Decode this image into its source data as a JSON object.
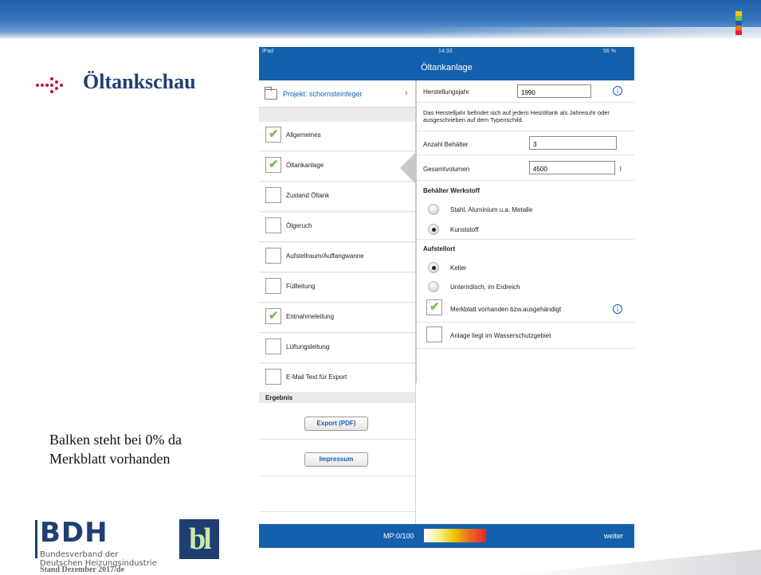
{
  "brand": {
    "accent": "#1560ad",
    "title_color": "#1f3e72",
    "check_color": "#7cc044"
  },
  "slide": {
    "title": "Öltankschau",
    "caption_line1": "Balken steht bei 0% da",
    "caption_line2": "Merkblatt vorhanden",
    "bdh_mark": "BDH",
    "bdh_sub1": "Bundesverband der",
    "bdh_sub2": "Deutschen Heizungsindustrie",
    "stand": "Stand Dezember 2017/de",
    "bl_logo": "bl"
  },
  "status": {
    "device": "iPad",
    "time": "14:33",
    "battery": "56 %"
  },
  "nav": {
    "title": "Öltankanlage"
  },
  "project": {
    "label": "Projekt: schornsteinfeger"
  },
  "sidebar": {
    "items": [
      {
        "label": "Allgemeines",
        "checked": true
      },
      {
        "label": "Öltankanlage",
        "checked": true
      },
      {
        "label": "Zustand Öltank",
        "checked": false
      },
      {
        "label": "Ölgeruch",
        "checked": false
      },
      {
        "label": "Aufstellraum/Auffangwanne",
        "checked": false
      },
      {
        "label": "Füllleitung",
        "checked": false
      },
      {
        "label": "Entnahmeleitung",
        "checked": true
      },
      {
        "label": "Lüftungsleitung",
        "checked": false
      },
      {
        "label": "E-Mail Text für Export",
        "checked": false
      }
    ],
    "section_result": "Ergebnis",
    "export_button": "Export (PDF)",
    "impressum_button": "Impressum"
  },
  "form": {
    "year_label": "Herstellungsjahr",
    "year_value": "1990",
    "hint": "Das Herstelljahr befindet sich auf jedem Heizöltank als Jahresuhr oder ausgeschrieben auf dem Typenschild.",
    "count_label": "Anzahl Behälter",
    "count_value": "3",
    "volume_label": "Gesamtvolumen",
    "volume_value": "4500",
    "volume_unit": "l",
    "material_section": "Behälter Werkstoff",
    "material_options": [
      {
        "label": "Stahl, Aluminium u.a. Metalle",
        "selected": false
      },
      {
        "label": "Kunststoff",
        "selected": true
      }
    ],
    "location_section": "Aufstellort",
    "location_options": [
      {
        "label": "Keller",
        "selected": true
      },
      {
        "label": "Unterirdisch, im Erdreich",
        "selected": false
      }
    ],
    "merkblatt_label": "Merkblatt vorhanden bzw.ausgehändigt",
    "merkblatt_checked": true,
    "wasserschutz_label": "Anlage liegt im Wasserschutzgebiet",
    "wasserschutz_checked": false
  },
  "bottombar": {
    "mp_label": "MP:0/100",
    "progress_percent": 0,
    "next_label": "weiter"
  }
}
